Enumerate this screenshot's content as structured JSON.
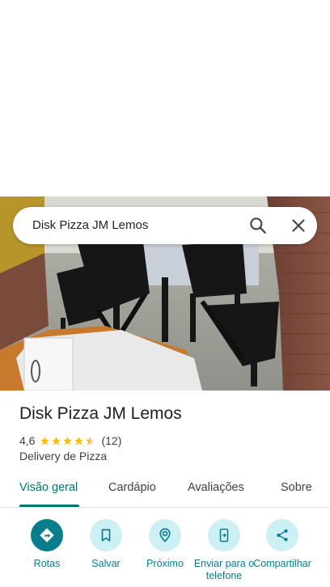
{
  "search": {
    "query": "Disk Pizza JM Lemos",
    "search_icon": "search-icon",
    "close_icon": "close-icon"
  },
  "place": {
    "name": "Disk Pizza JM Lemos",
    "rating": "4,6",
    "rating_value": 4.6,
    "reviews_count": "(12)",
    "category": "Delivery de Pizza"
  },
  "tabs": [
    {
      "label": "Visão geral",
      "active": true
    },
    {
      "label": "Cardápio",
      "active": false
    },
    {
      "label": "Avaliações",
      "active": false
    },
    {
      "label": "Sobre",
      "active": false
    }
  ],
  "actions": [
    {
      "label": "Rotas",
      "icon": "directions-icon"
    },
    {
      "label": "Salvar",
      "icon": "bookmark-icon"
    },
    {
      "label": "Próximo",
      "icon": "nearby-icon"
    },
    {
      "label": "Enviar para o telefone",
      "icon": "send-to-phone-icon"
    },
    {
      "label": "Compartilhar",
      "icon": "share-icon"
    }
  ],
  "colors": {
    "accent": "#00796b",
    "action_text": "#087d8c",
    "action_bg": "#cdf0f5",
    "star": "#fbbc04"
  }
}
